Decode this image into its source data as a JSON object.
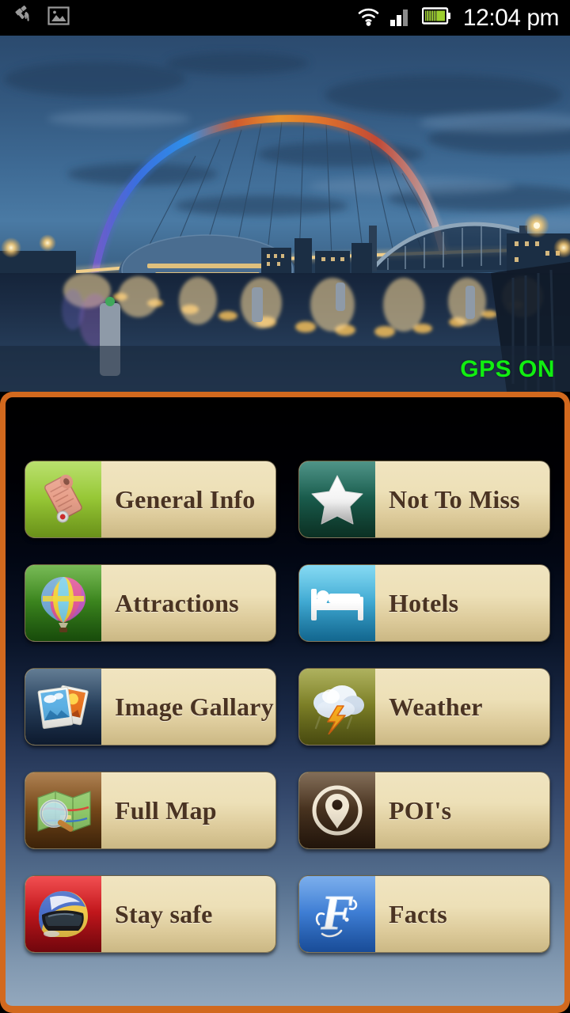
{
  "statusbar": {
    "time": "12:04 pm",
    "left_icons": [
      {
        "name": "gps-satellite-icon",
        "label": "GPS satellite"
      },
      {
        "name": "image-saved-icon",
        "label": "Image"
      }
    ],
    "right_icons": [
      {
        "name": "wifi-icon",
        "label": "Wi-Fi"
      },
      {
        "name": "cellular-signal-icon",
        "label": "Signal"
      },
      {
        "name": "battery-icon",
        "label": "Battery"
      }
    ]
  },
  "hero": {
    "alt": "Gateshead Millennium Bridge over the River Tyne at dusk",
    "gps_status": "GPS ON",
    "gps_color": "#11ee11"
  },
  "panel": {
    "border_color": "#d2691e"
  },
  "menu": {
    "items": [
      {
        "label": "General Info",
        "icon": "scroll-map-icon",
        "tile_color": "#9ccb3b",
        "tile_color2": "#7fae22"
      },
      {
        "label": "Not To Miss",
        "icon": "star-icon",
        "tile_color": "#1f6b5c",
        "tile_color2": "#10402f"
      },
      {
        "label": "Attractions",
        "icon": "hot-air-balloon-icon",
        "tile_color": "#4a9a27",
        "tile_color2": "#206010"
      },
      {
        "label": "Hotels",
        "icon": "bed-icon",
        "tile_color": "#59c6ea",
        "tile_color2": "#1b82b4"
      },
      {
        "label": "Image Gallary",
        "icon": "photo-stack-icon",
        "tile_color": "#33506b",
        "tile_color2": "#14253a"
      },
      {
        "label": "Weather",
        "icon": "storm-cloud-icon",
        "tile_color": "#8a8f2e",
        "tile_color2": "#5d5f16"
      },
      {
        "label": "Full Map",
        "icon": "folded-map-icon",
        "tile_color": "#8d5a23",
        "tile_color2": "#4e2d0c"
      },
      {
        "label": "POI's",
        "icon": "map-pin-circle-icon",
        "tile_color": "#57412f",
        "tile_color2": "#2a1b11"
      },
      {
        "label": "Stay safe",
        "icon": "helmet-icon",
        "tile_color": "#e21f22",
        "tile_color2": "#8a0b12"
      },
      {
        "label": "Facts",
        "icon": "script-f-icon",
        "tile_color": "#4a8fe0",
        "tile_color2": "#1f5fbd"
      }
    ]
  }
}
